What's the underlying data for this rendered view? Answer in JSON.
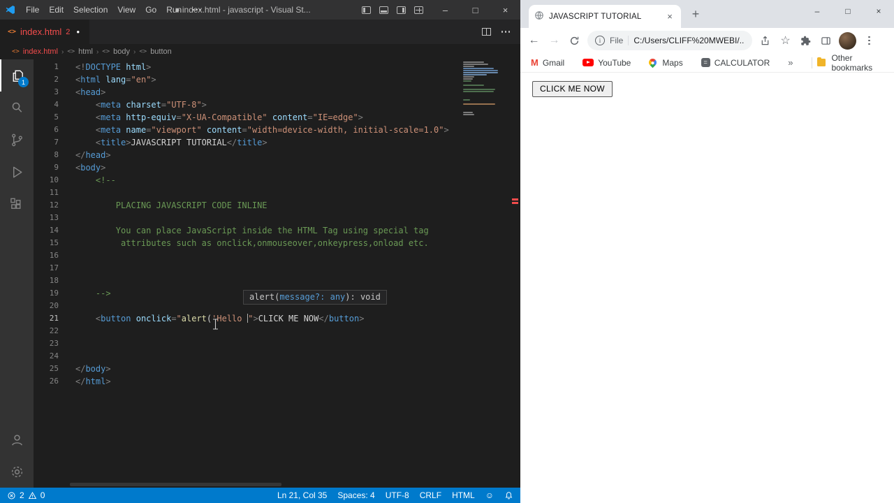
{
  "vscode": {
    "titlebar": {
      "menus": [
        "File",
        "Edit",
        "Selection",
        "View",
        "Go",
        "Run"
      ],
      "window_title": "● index.html - javascript - Visual St...",
      "controls": {
        "minimize": "–",
        "maximize": "□",
        "close": "×"
      }
    },
    "tab": {
      "file_icon": "<>",
      "label": "index.html",
      "error_badge": "2",
      "modified_dot": "●"
    },
    "breadcrumbs": {
      "file_icon": "<>",
      "symbol_icon": "<>",
      "separator": "›",
      "items": [
        {
          "label": "index.html"
        },
        {
          "label": "html"
        },
        {
          "label": "body"
        },
        {
          "label": "button"
        }
      ]
    },
    "activity": {
      "explorer_badge": "1"
    },
    "editor": {
      "lines": [
        [
          [
            "p",
            "<!"
          ],
          [
            "t",
            "DOCTYPE"
          ],
          [
            "x",
            " "
          ],
          [
            "a",
            "html"
          ],
          [
            "p",
            ">"
          ]
        ],
        [
          [
            "p",
            "<"
          ],
          [
            "t",
            "html"
          ],
          [
            "x",
            " "
          ],
          [
            "a",
            "lang"
          ],
          [
            "p",
            "="
          ],
          [
            "s",
            "\"en\""
          ],
          [
            "p",
            ">"
          ]
        ],
        [
          [
            "p",
            "<"
          ],
          [
            "t",
            "head"
          ],
          [
            "p",
            ">"
          ]
        ],
        [
          [
            "x",
            "    "
          ],
          [
            "p",
            "<"
          ],
          [
            "t",
            "meta"
          ],
          [
            "x",
            " "
          ],
          [
            "a",
            "charset"
          ],
          [
            "p",
            "="
          ],
          [
            "s",
            "\"UTF-8\""
          ],
          [
            "p",
            ">"
          ]
        ],
        [
          [
            "x",
            "    "
          ],
          [
            "p",
            "<"
          ],
          [
            "t",
            "meta"
          ],
          [
            "x",
            " "
          ],
          [
            "a",
            "http-equiv"
          ],
          [
            "p",
            "="
          ],
          [
            "s",
            "\"X-UA-Compatible\""
          ],
          [
            "x",
            " "
          ],
          [
            "a",
            "content"
          ],
          [
            "p",
            "="
          ],
          [
            "s",
            "\"IE=edge\""
          ],
          [
            "p",
            ">"
          ]
        ],
        [
          [
            "x",
            "    "
          ],
          [
            "p",
            "<"
          ],
          [
            "t",
            "meta"
          ],
          [
            "x",
            " "
          ],
          [
            "a",
            "name"
          ],
          [
            "p",
            "="
          ],
          [
            "s",
            "\"viewport\""
          ],
          [
            "x",
            " "
          ],
          [
            "a",
            "content"
          ],
          [
            "p",
            "="
          ],
          [
            "s",
            "\"width=device-width, initial-scale=1.0\""
          ],
          [
            "p",
            ">"
          ]
        ],
        [
          [
            "x",
            "    "
          ],
          [
            "p",
            "<"
          ],
          [
            "t",
            "title"
          ],
          [
            "p",
            ">"
          ],
          [
            "x",
            "JAVASCRIPT TUTORIAL"
          ],
          [
            "p",
            "</"
          ],
          [
            "t",
            "title"
          ],
          [
            "p",
            ">"
          ]
        ],
        [
          [
            "p",
            "</"
          ],
          [
            "t",
            "head"
          ],
          [
            "p",
            ">"
          ]
        ],
        [
          [
            "p",
            "<"
          ],
          [
            "t",
            "body"
          ],
          [
            "p",
            ">"
          ]
        ],
        [
          [
            "x",
            "    "
          ],
          [
            "c",
            "<!--"
          ]
        ],
        [],
        [
          [
            "c",
            "        PLACING JAVASCRIPT CODE INLINE"
          ]
        ],
        [],
        [
          [
            "c",
            "        You can place JavaScript inside the HTML Tag using special tag"
          ]
        ],
        [
          [
            "c",
            "         attributes such as onclick,onmouseover,onkeypress,onload etc."
          ]
        ],
        [],
        [],
        [],
        [
          [
            "x",
            "    "
          ],
          [
            "c",
            "-->"
          ]
        ],
        [],
        [
          [
            "x",
            "    "
          ],
          [
            "p",
            "<"
          ],
          [
            "t",
            "button"
          ],
          [
            "x",
            " "
          ],
          [
            "a",
            "onclick"
          ],
          [
            "p",
            "="
          ],
          [
            "s",
            "\""
          ],
          [
            "f",
            "alert"
          ],
          [
            "x",
            "("
          ],
          [
            "s",
            "'Hello "
          ],
          [
            "caret",
            ""
          ],
          [
            "s",
            "\""
          ],
          [
            "p",
            ">"
          ],
          [
            "x",
            "CLICK ME NOW"
          ],
          [
            "p",
            "</"
          ],
          [
            "t",
            "button"
          ],
          [
            "p",
            ">"
          ]
        ],
        [],
        [],
        [],
        [
          [
            "p",
            "</"
          ],
          [
            "t",
            "body"
          ],
          [
            "p",
            ">"
          ]
        ],
        [
          [
            "p",
            "</"
          ],
          [
            "t",
            "html"
          ],
          [
            "p",
            ">"
          ]
        ]
      ],
      "active_line": 21,
      "hint": [
        [
          "plain",
          "alert("
        ],
        [
          "param",
          "message?: any"
        ],
        [
          "plain",
          "): void"
        ]
      ]
    },
    "statusbar": {
      "error_count": "2",
      "warning_count": "0",
      "cursor_position": "Ln 21, Col 35",
      "indentation": "Spaces: 4",
      "encoding": "UTF-8",
      "eol": "CRLF",
      "language": "HTML",
      "feedback": "☺"
    }
  },
  "browser": {
    "tab": {
      "title": "JAVASCRIPT TUTORIAL",
      "close": "×"
    },
    "new_tab": "+",
    "controls": {
      "minimize": "–",
      "maximize": "□",
      "close": "×"
    },
    "navigation": {
      "back": "←",
      "forward": "→"
    },
    "address": {
      "scheme": "File",
      "url": "C:/Users/CLIFF%20MWEBI/..."
    },
    "bookmarks": {
      "items": [
        {
          "label": "Gmail"
        },
        {
          "label": "YouTube"
        },
        {
          "label": "Maps"
        },
        {
          "label": "CALCULATOR"
        }
      ],
      "overflow": "»",
      "other": "Other bookmarks"
    },
    "page": {
      "button_label": "CLICK ME NOW"
    }
  },
  "colors": {
    "accent": "#007acc",
    "error": "#f14c4c",
    "tag": "#569cd6",
    "attribute": "#9cdcfe",
    "string": "#ce9178",
    "comment": "#6a9955",
    "function": "#dcdcaa"
  }
}
